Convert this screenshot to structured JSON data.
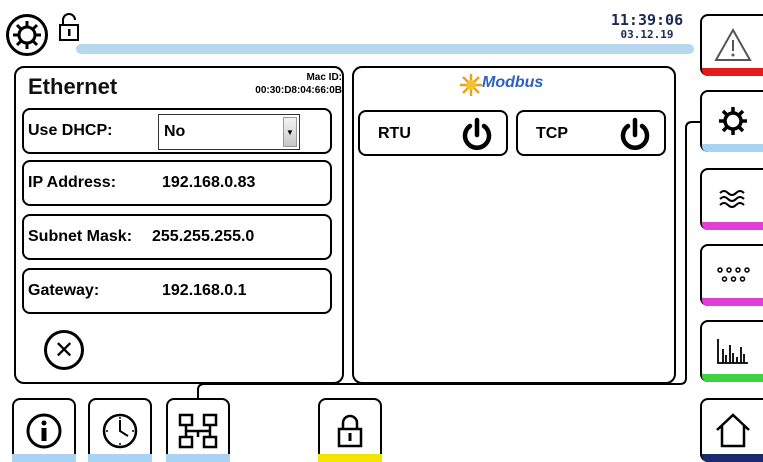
{
  "header": {
    "time": "11:39:06",
    "date": "03.12.19",
    "progress_fraction": 1.0
  },
  "ethernet": {
    "title": "Ethernet",
    "mac_label": "Mac ID:",
    "mac_value": "00:30:D8:04:66:0B",
    "dhcp": {
      "label": "Use DHCP:",
      "value": "No"
    },
    "ip": {
      "label": "IP Address:",
      "value": "192.168.0.83"
    },
    "subnet": {
      "label": "Subnet Mask:",
      "value": "255.255.255.0"
    },
    "gateway": {
      "label": "Gateway:",
      "value": "192.168.0.1"
    }
  },
  "modbus": {
    "logo_text": "Modbus",
    "rtu_label": "RTU",
    "tcp_label": "TCP"
  },
  "right_nav": [
    {
      "icon": "warning-icon",
      "color": "#e31b1b"
    },
    {
      "icon": "gear-icon",
      "color": "#a9d3f2"
    },
    {
      "icon": "waves-icon",
      "color": "#e040d8"
    },
    {
      "icon": "dots-icon",
      "color": "#e040d8"
    },
    {
      "icon": "bar-chart-icon",
      "color": "#3fd43f"
    },
    {
      "icon": "home-icon",
      "color": "#1a2a6a"
    }
  ],
  "bottom_nav": [
    {
      "icon": "info-icon",
      "color": "#a9d3f2"
    },
    {
      "icon": "clock-icon",
      "color": "#a9d3f2"
    },
    {
      "icon": "network-icon",
      "color": "#a9d3f2"
    },
    {
      "icon": "lock-icon",
      "color": "#f2e600"
    }
  ]
}
